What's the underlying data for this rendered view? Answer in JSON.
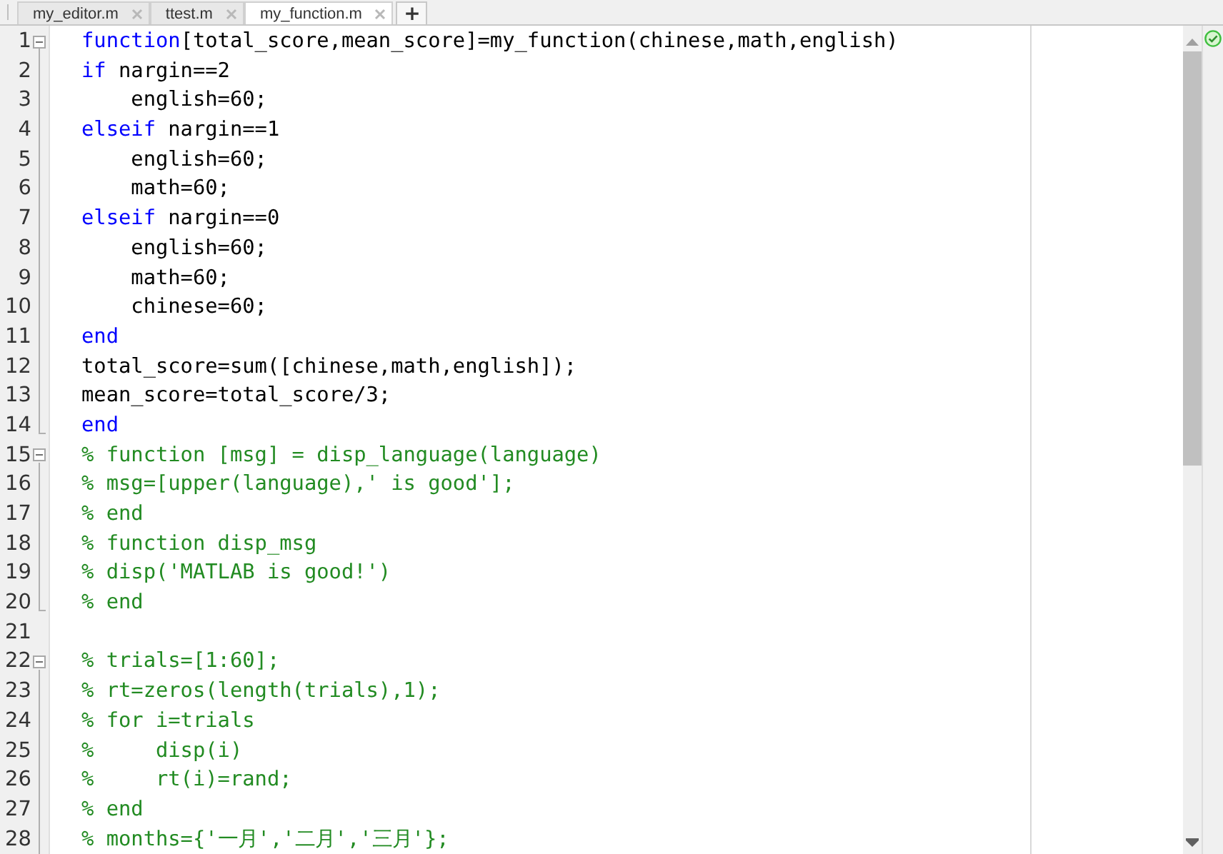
{
  "tabs": [
    {
      "label": "my_editor.m",
      "selected": false
    },
    {
      "label": "ttest.m",
      "selected": false
    },
    {
      "label": "my_function.m",
      "selected": true
    }
  ],
  "new_tab": "+",
  "lines": [
    {
      "number": "1",
      "fold_start": true,
      "fold_end": false,
      "tokens": [
        {
          "kind": "keyword",
          "text": "function"
        },
        {
          "kind": "plain",
          "text": "[total_score,mean_score]=my_function(chinese,math,english)"
        }
      ]
    },
    {
      "number": "2",
      "fold_start": false,
      "fold_end": false,
      "tokens": [
        {
          "kind": "keyword",
          "text": "if"
        },
        {
          "kind": "plain",
          "text": " nargin==2"
        }
      ]
    },
    {
      "number": "3",
      "fold_start": false,
      "fold_end": false,
      "tokens": [
        {
          "kind": "plain",
          "text": "    english=60;"
        }
      ]
    },
    {
      "number": "4",
      "fold_start": false,
      "fold_end": false,
      "tokens": [
        {
          "kind": "keyword",
          "text": "elseif"
        },
        {
          "kind": "plain",
          "text": " nargin==1"
        }
      ]
    },
    {
      "number": "5",
      "fold_start": false,
      "fold_end": false,
      "tokens": [
        {
          "kind": "plain",
          "text": "    english=60;"
        }
      ]
    },
    {
      "number": "6",
      "fold_start": false,
      "fold_end": false,
      "tokens": [
        {
          "kind": "plain",
          "text": "    math=60;"
        }
      ]
    },
    {
      "number": "7",
      "fold_start": false,
      "fold_end": false,
      "tokens": [
        {
          "kind": "keyword",
          "text": "elseif"
        },
        {
          "kind": "plain",
          "text": " nargin==0"
        }
      ]
    },
    {
      "number": "8",
      "fold_start": false,
      "fold_end": false,
      "tokens": [
        {
          "kind": "plain",
          "text": "    english=60;"
        }
      ]
    },
    {
      "number": "9",
      "fold_start": false,
      "fold_end": false,
      "tokens": [
        {
          "kind": "plain",
          "text": "    math=60;"
        }
      ]
    },
    {
      "number": "10",
      "fold_start": false,
      "fold_end": false,
      "tokens": [
        {
          "kind": "plain",
          "text": "    chinese=60;"
        }
      ]
    },
    {
      "number": "11",
      "fold_start": false,
      "fold_end": false,
      "tokens": [
        {
          "kind": "keyword",
          "text": "end"
        }
      ]
    },
    {
      "number": "12",
      "fold_start": false,
      "fold_end": false,
      "tokens": [
        {
          "kind": "plain",
          "text": "total_score=sum([chinese,math,english]);"
        }
      ]
    },
    {
      "number": "13",
      "fold_start": false,
      "fold_end": false,
      "tokens": [
        {
          "kind": "plain",
          "text": "mean_score=total_score/3;"
        }
      ]
    },
    {
      "number": "14",
      "fold_start": false,
      "fold_end": true,
      "tokens": [
        {
          "kind": "keyword",
          "text": "end"
        }
      ]
    },
    {
      "number": "15",
      "fold_start": true,
      "fold_end": false,
      "tokens": [
        {
          "kind": "comment",
          "text": "% function [msg] = disp_language(language)"
        }
      ]
    },
    {
      "number": "16",
      "fold_start": false,
      "fold_end": false,
      "tokens": [
        {
          "kind": "comment",
          "text": "% msg=[upper(language),' is good'];"
        }
      ]
    },
    {
      "number": "17",
      "fold_start": false,
      "fold_end": false,
      "tokens": [
        {
          "kind": "comment",
          "text": "% end"
        }
      ]
    },
    {
      "number": "18",
      "fold_start": false,
      "fold_end": false,
      "tokens": [
        {
          "kind": "comment",
          "text": "% function disp_msg"
        }
      ]
    },
    {
      "number": "19",
      "fold_start": false,
      "fold_end": false,
      "tokens": [
        {
          "kind": "comment",
          "text": "% disp('MATLAB is good!')"
        }
      ]
    },
    {
      "number": "20",
      "fold_start": false,
      "fold_end": true,
      "tokens": [
        {
          "kind": "comment",
          "text": "% end"
        }
      ]
    },
    {
      "number": "21",
      "fold_start": false,
      "fold_end": false
    },
    {
      "number": "22",
      "fold_start": true,
      "fold_end": false,
      "tokens": [
        {
          "kind": "comment",
          "text": "% trials=[1:60];"
        }
      ]
    },
    {
      "number": "23",
      "fold_start": false,
      "fold_end": false,
      "tokens": [
        {
          "kind": "comment",
          "text": "% rt=zeros(length(trials),1);"
        }
      ]
    },
    {
      "number": "24",
      "fold_start": false,
      "fold_end": false,
      "tokens": [
        {
          "kind": "comment",
          "text": "% for i=trials"
        }
      ]
    },
    {
      "number": "25",
      "fold_start": false,
      "fold_end": false,
      "tokens": [
        {
          "kind": "comment",
          "text": "%     disp(i)"
        }
      ]
    },
    {
      "number": "26",
      "fold_start": false,
      "fold_end": false,
      "tokens": [
        {
          "kind": "comment",
          "text": "%     rt(i)=rand;"
        }
      ]
    },
    {
      "number": "27",
      "fold_start": false,
      "fold_end": false,
      "tokens": [
        {
          "kind": "comment",
          "text": "% end"
        }
      ]
    },
    {
      "number": "28",
      "fold_start": false,
      "fold_end": false,
      "tokens": [
        {
          "kind": "comment",
          "text": "% months={'一月','二月','三月'};"
        }
      ]
    }
  ]
}
